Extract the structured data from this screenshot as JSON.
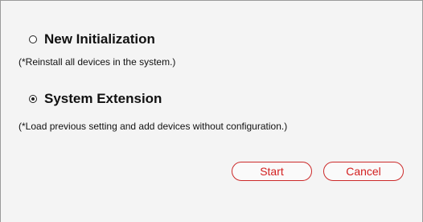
{
  "options": [
    {
      "label": "New Initialization",
      "note": "(*Reinstall all devices in the system.)",
      "selected": false
    },
    {
      "label": "System Extension",
      "note": "(*Load previous setting and add devices without configuration.)",
      "selected": true
    }
  ],
  "buttons": {
    "start_label": "Start",
    "cancel_label": "Cancel"
  },
  "colors": {
    "button_accent": "#d32020",
    "background": "#f4f4f4"
  }
}
